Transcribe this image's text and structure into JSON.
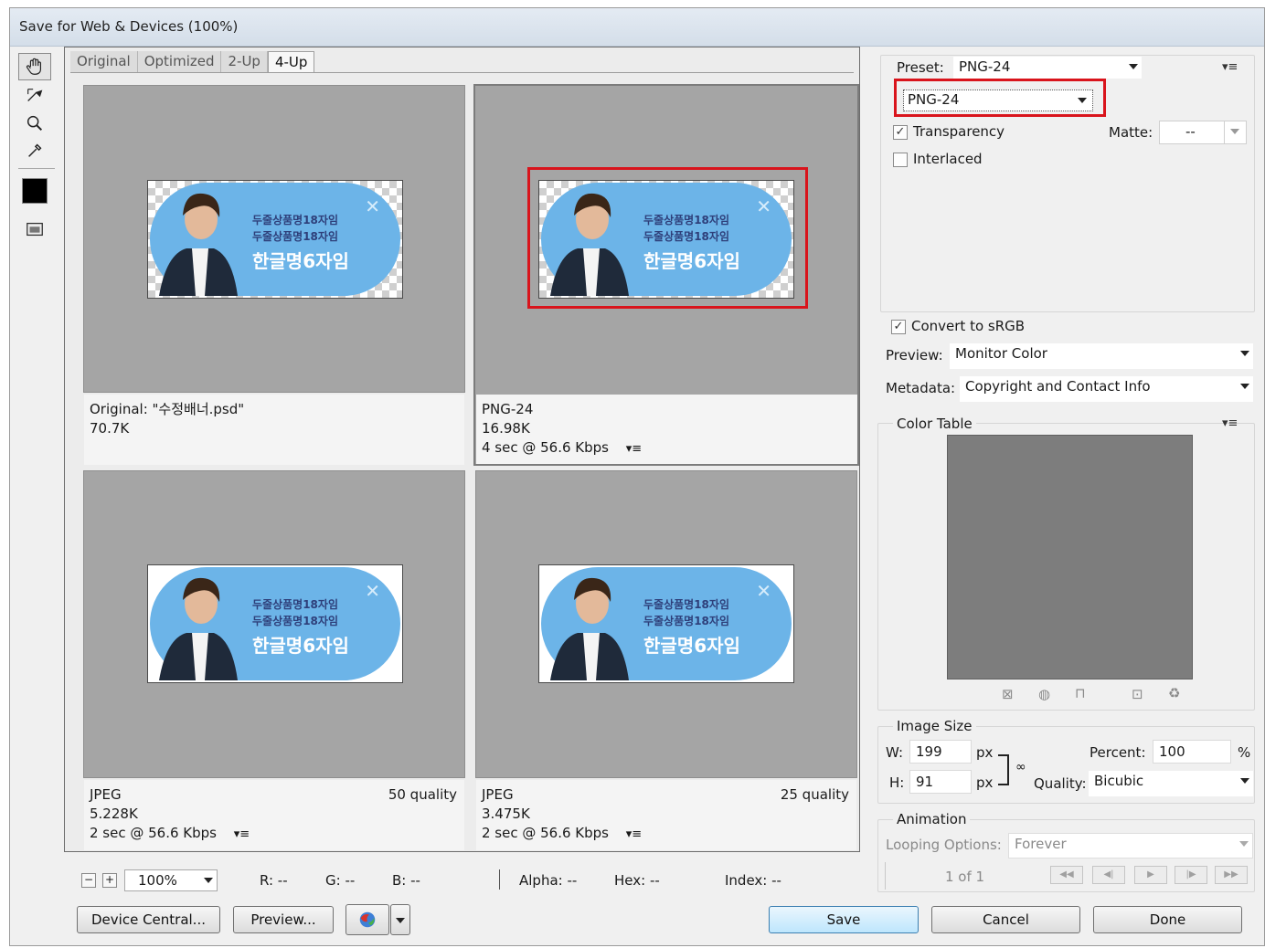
{
  "window": {
    "title": "Save for Web & Devices (100%)"
  },
  "tabs": [
    "Original",
    "Optimized",
    "2-Up",
    "4-Up"
  ],
  "active_tab": "4-Up",
  "banner": {
    "line1": "두줄상품명18자임",
    "line2": "두줄상품명18자임",
    "line3": "한글명6자임"
  },
  "panes": [
    {
      "line1": "Original: \"수정배너.psd\"",
      "line2": "70.7K",
      "line3": "",
      "quality": ""
    },
    {
      "line1": "PNG-24",
      "line2": "16.98K",
      "line3": "4 sec @ 56.6 Kbps",
      "quality": ""
    },
    {
      "line1": "JPEG",
      "line2": "5.228K",
      "line3": "2 sec @ 56.6 Kbps",
      "quality": "50 quality"
    },
    {
      "line1": "JPEG",
      "line2": "3.475K",
      "line3": "2 sec @ 56.6 Kbps",
      "quality": "25 quality"
    }
  ],
  "status": {
    "zoom": "100%",
    "r": "R: --",
    "g": "G: --",
    "b": "B: --",
    "alpha": "Alpha: --",
    "hex": "Hex: --",
    "index": "Index: --"
  },
  "bottom_buttons": {
    "device_central": "Device Central...",
    "preview": "Preview...",
    "save": "Save",
    "cancel": "Cancel",
    "done": "Done"
  },
  "settings": {
    "preset_label": "Preset:",
    "preset_value": "PNG-24",
    "format_value": "PNG-24",
    "transparency": "Transparency",
    "transparency_checked": true,
    "matte_label": "Matte:",
    "matte_value": "--",
    "interlaced": "Interlaced",
    "interlaced_checked": false,
    "convert_srgb": "Convert to sRGB",
    "convert_srgb_checked": true,
    "preview_label": "Preview:",
    "preview_value": "Monitor Color",
    "metadata_label": "Metadata:",
    "metadata_value": "Copyright and Contact Info"
  },
  "color_table": {
    "label": "Color Table"
  },
  "image_size": {
    "label": "Image Size",
    "w_label": "W:",
    "w_value": "199",
    "w_unit": "px",
    "h_label": "H:",
    "h_value": "91",
    "h_unit": "px",
    "percent_label": "Percent:",
    "percent_value": "100",
    "percent_unit": "%",
    "quality_label": "Quality:",
    "quality_value": "Bicubic"
  },
  "animation": {
    "label": "Animation",
    "looping_label": "Looping Options:",
    "looping_value": "Forever",
    "frame_counter": "1 of 1"
  },
  "highlight_color": "#d9141c"
}
